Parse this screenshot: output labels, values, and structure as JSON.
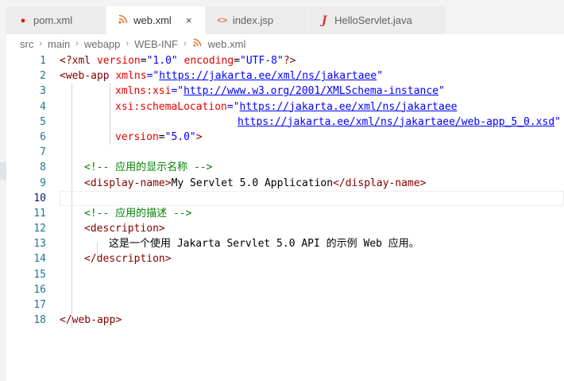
{
  "tabs": [
    {
      "label": "pom.xml",
      "icon": "maven-file-icon",
      "active": false
    },
    {
      "label": "web.xml",
      "icon": "xml-rss-icon",
      "active": true,
      "close": "×"
    },
    {
      "label": "index.jsp",
      "icon": "code-brackets-icon",
      "active": false
    },
    {
      "label": "HelloServlet.java",
      "icon": "java-file-icon",
      "active": false
    }
  ],
  "breadcrumb": {
    "items": [
      "src",
      "main",
      "webapp",
      "WEB-INF",
      "web.xml"
    ],
    "separator": "›"
  },
  "editor": {
    "line_numbers": [
      "1",
      "2",
      "3",
      "4",
      "5",
      "6",
      "7",
      "8",
      "9",
      "10",
      "11",
      "12",
      "13",
      "14",
      "15",
      "16",
      "17",
      "18"
    ],
    "current_line": 10,
    "code": {
      "l1_decl_open": "<?xml ",
      "l1_attr1": "version",
      "l1_eq1": "=",
      "l1_val1": "\"1.0\"",
      "l1_attr2": " encoding",
      "l1_eq2": "=",
      "l1_val2": "\"UTF-8\"",
      "l1_decl_close": "?>",
      "l2_open": "<web-app ",
      "l2_attr": "xmlns",
      "l2_eq": "=\"",
      "l2_url": "https://jakarta.ee/xml/ns/jakartaee",
      "l2_q": "\"",
      "l3_attr": "xmlns:xsi",
      "l3_eq": "=\"",
      "l3_url": "http://www.w3.org/2001/XMLSchema-instance",
      "l3_q": "\"",
      "l4_attr": "xsi:schemaLocation",
      "l4_eq": "=\"",
      "l4_url": "https://jakarta.ee/xml/ns/jakartaee",
      "l5_url": "https://jakarta.ee/xml/ns/jakartaee/web-app_5_0.xsd",
      "l5_q": "\"",
      "l6_attr": "version",
      "l6_eq": "=",
      "l6_val": "\"5.0\"",
      "l6_close": ">",
      "l8_comment": "<!-- 应用的显示名称 -->",
      "l9_open": "<display-name>",
      "l9_text": "My Servlet 5.0 Application",
      "l9_close": "</display-name>",
      "l11_comment": "<!-- 应用的描述 -->",
      "l12_open": "<description>",
      "l13_text": "这是一个使用 Jakarta Servlet 5.0 API 的示例 Web 应用。",
      "l14_close": "</description>",
      "l18_close": "</web-app>"
    }
  },
  "colors": {
    "tag": "#800000",
    "attribute": "#e50000",
    "value": "#0000ff",
    "comment": "#008000",
    "line_number": "#237893"
  }
}
